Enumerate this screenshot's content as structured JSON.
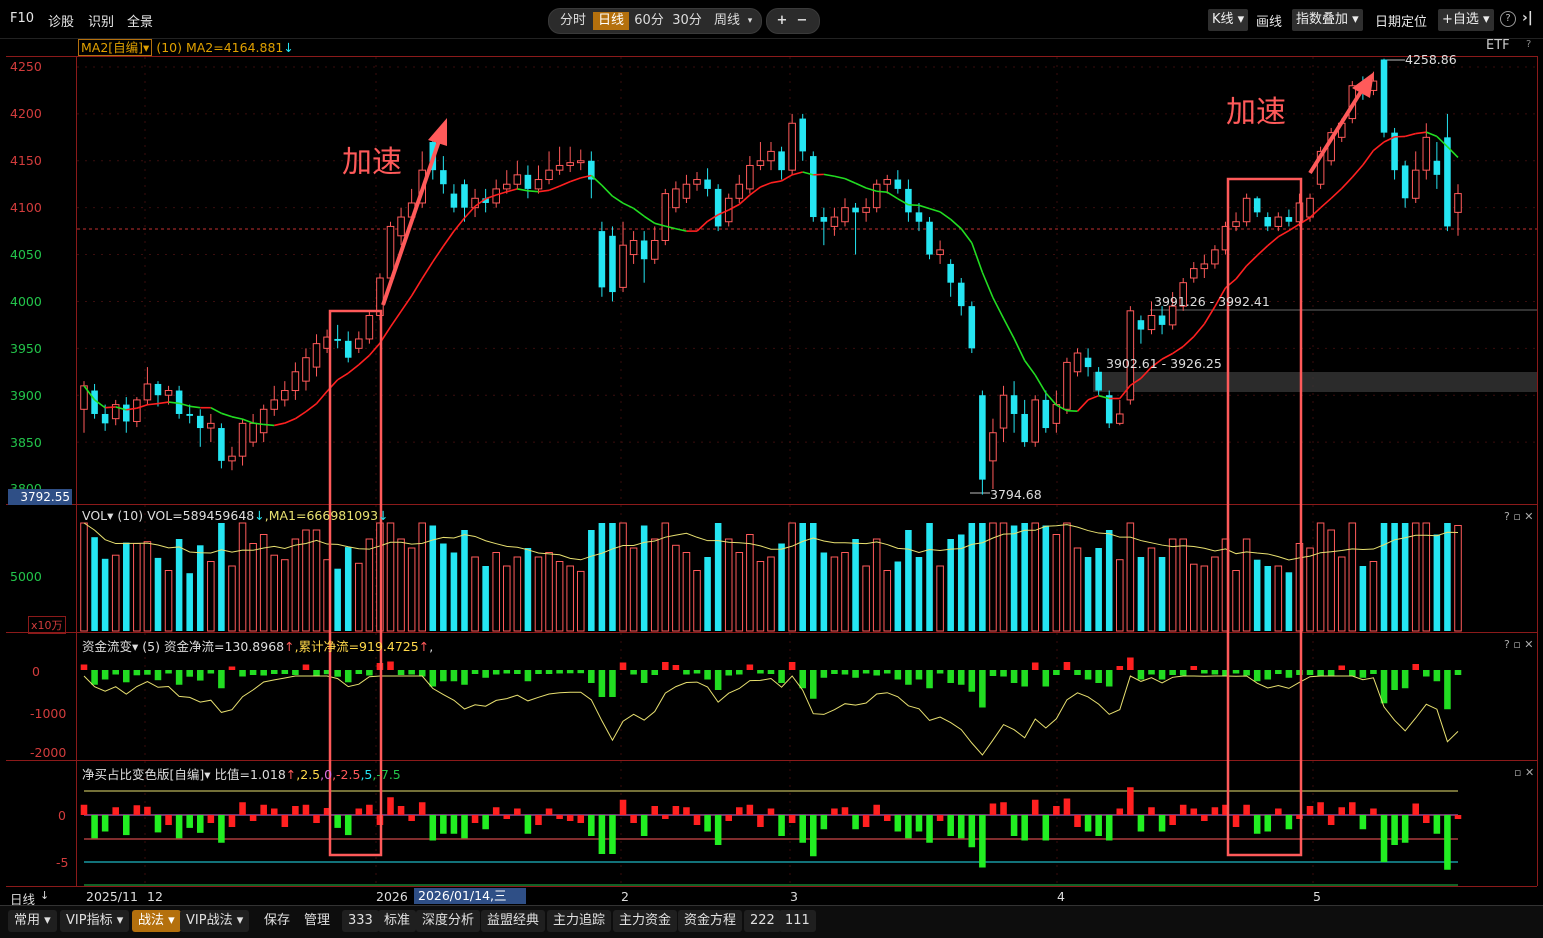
{
  "topbar": {
    "f10": "F10",
    "diagnose": "诊股",
    "recognize": "识别",
    "panorama": "全景",
    "modes": [
      "分时",
      "日线",
      "60分",
      "30分",
      "周线"
    ],
    "zoom_in": "+",
    "zoom_out": "−",
    "kline": "K线",
    "draw": "画线",
    "index_overlay": "指数叠加",
    "date_locate": "日期定位",
    "add_watch": "+自选",
    "help": "?",
    "etf": "ETF",
    "etf_help": "?"
  },
  "main": {
    "indicator_name": "MA2[自编]",
    "indicator_param": "(10)",
    "ma_value": "MA2=4164.881",
    "y_ticks": [
      "4250",
      "4200",
      "4150",
      "4100",
      "4050",
      "4000",
      "3950",
      "3900",
      "3850",
      "3800"
    ],
    "current_price": "3792.55",
    "high_label": "4258.86",
    "low_label": "3794.68",
    "zone_upper": "3991.26 - 3992.41",
    "zone_lower": "3902.61 - 3926.25",
    "annotation_1": "加速",
    "annotation_2": "加速"
  },
  "vol": {
    "title": "VOL",
    "param": "(10)",
    "vol_value": "VOL=589459648",
    "ma_value": ",MA1=666981093",
    "y_ticks": [
      "5000"
    ],
    "unit": "x10万"
  },
  "fund": {
    "title": "资金流变",
    "param": "(5)",
    "net": "资金净流=130.8968",
    "cum": "累计净流=919.4725",
    "y_ticks": [
      "0",
      "-1000",
      "-2000"
    ]
  },
  "netbuy": {
    "title": "净买占比变色版[自编]",
    "ratio": "比值=1.018",
    "lines": [
      ",2.5",
      ",0",
      ",-2.5",
      ",5",
      ",-7.5"
    ],
    "y_ticks": [
      "0",
      "-5"
    ]
  },
  "xaxis": {
    "period": "日线",
    "labels": [
      "2025/11",
      "12",
      "2026",
      "2",
      "3",
      "4",
      "5"
    ],
    "cursor_date": "2026/01/14,三"
  },
  "bottombar": {
    "items": [
      "常用",
      "VIP指标",
      "战法",
      "VIP战法",
      "保存",
      "管理",
      "333",
      "标准",
      "深度分析",
      "益盟经典",
      "主力追踪",
      "主力资金",
      "资金方程",
      "222",
      "111"
    ]
  },
  "colors": {
    "up": "#ff5a5a",
    "down": "#25e5f2",
    "ma_up": "#ff2020",
    "ma_down": "#22dd22",
    "grid_red": "#8b1a1a",
    "accent": "#b4700d"
  },
  "chart_data": {
    "type": "candlestick",
    "candles": [
      [
        3885,
        3910,
        3860,
        3915
      ],
      [
        3905,
        3880,
        3875,
        3912
      ],
      [
        3880,
        3870,
        3862,
        3890
      ],
      [
        3875,
        3890,
        3868,
        3895
      ],
      [
        3890,
        3872,
        3860,
        3898
      ],
      [
        3872,
        3895,
        3866,
        3898
      ],
      [
        3895,
        3912,
        3890,
        3930
      ],
      [
        3912,
        3900,
        3888,
        3915
      ],
      [
        3900,
        3905,
        3890,
        3910
      ],
      [
        3905,
        3880,
        3875,
        3910
      ],
      [
        3880,
        3878,
        3870,
        3890
      ],
      [
        3878,
        3865,
        3845,
        3885
      ],
      [
        3865,
        3870,
        3850,
        3880
      ],
      [
        3865,
        3830,
        3822,
        3870
      ],
      [
        3830,
        3835,
        3820,
        3845
      ],
      [
        3835,
        3870,
        3825,
        3875
      ],
      [
        3850,
        3870,
        3845,
        3880
      ],
      [
        3860,
        3885,
        3850,
        3890
      ],
      [
        3885,
        3895,
        3878,
        3910
      ],
      [
        3895,
        3905,
        3888,
        3915
      ],
      [
        3905,
        3925,
        3895,
        3935
      ],
      [
        3915,
        3940,
        3905,
        3950
      ],
      [
        3930,
        3955,
        3920,
        3965
      ],
      [
        3950,
        3962,
        3945,
        3970
      ],
      [
        3960,
        3958,
        3950,
        3975
      ],
      [
        3958,
        3940,
        3935,
        3968
      ],
      [
        3950,
        3960,
        3945,
        3968
      ],
      [
        3960,
        3985,
        3955,
        3990
      ],
      [
        3985,
        4025,
        3980,
        4030
      ],
      [
        4025,
        4080,
        4020,
        4085
      ],
      [
        4070,
        4090,
        4060,
        4100
      ],
      [
        4090,
        4105,
        4085,
        4120
      ],
      [
        4105,
        4140,
        4100,
        4160
      ],
      [
        4170,
        4140,
        4130,
        4175
      ],
      [
        4140,
        4125,
        4115,
        4155
      ],
      [
        4115,
        4100,
        4095,
        4125
      ],
      [
        4125,
        4100,
        4085,
        4130
      ],
      [
        4100,
        4110,
        4090,
        4120
      ],
      [
        4110,
        4105,
        4095,
        4120
      ],
      [
        4105,
        4120,
        4100,
        4130
      ],
      [
        4120,
        4125,
        4115,
        4140
      ],
      [
        4125,
        4135,
        4120,
        4150
      ],
      [
        4135,
        4120,
        4110,
        4145
      ],
      [
        4120,
        4130,
        4115,
        4145
      ],
      [
        4130,
        4140,
        4125,
        4160
      ],
      [
        4140,
        4145,
        4135,
        4165
      ],
      [
        4145,
        4148,
        4138,
        4165
      ],
      [
        4148,
        4150,
        4140,
        4162
      ],
      [
        4150,
        4130,
        4110,
        4160
      ],
      [
        4075,
        4015,
        4005,
        4085
      ],
      [
        4070,
        4010,
        4000,
        4080
      ],
      [
        4015,
        4060,
        4010,
        4085
      ],
      [
        4050,
        4065,
        4040,
        4075
      ],
      [
        4065,
        4045,
        4020,
        4075
      ],
      [
        4045,
        4065,
        4040,
        4080
      ],
      [
        4065,
        4115,
        4060,
        4120
      ],
      [
        4100,
        4120,
        4095,
        4128
      ],
      [
        4110,
        4125,
        4105,
        4135
      ],
      [
        4125,
        4130,
        4118,
        4138
      ],
      [
        4130,
        4120,
        4112,
        4142
      ],
      [
        4120,
        4080,
        4075,
        4125
      ],
      [
        4085,
        4110,
        4080,
        4115
      ],
      [
        4110,
        4125,
        4105,
        4135
      ],
      [
        4120,
        4145,
        4115,
        4155
      ],
      [
        4145,
        4150,
        4140,
        4170
      ],
      [
        4150,
        4160,
        4140,
        4170
      ],
      [
        4160,
        4140,
        4130,
        4165
      ],
      [
        4140,
        4190,
        4135,
        4200
      ],
      [
        4195,
        4160,
        4150,
        4200
      ],
      [
        4155,
        4090,
        4085,
        4160
      ],
      [
        4090,
        4085,
        4060,
        4100
      ],
      [
        4080,
        4090,
        4070,
        4100
      ],
      [
        4085,
        4100,
        4080,
        4110
      ],
      [
        4100,
        4095,
        4050,
        4105
      ],
      [
        4095,
        4100,
        4085,
        4110
      ],
      [
        4100,
        4125,
        4095,
        4130
      ],
      [
        4125,
        4130,
        4115,
        4135
      ],
      [
        4130,
        4120,
        4115,
        4140
      ],
      [
        4120,
        4095,
        4085,
        4130
      ],
      [
        4095,
        4085,
        4075,
        4105
      ],
      [
        4085,
        4050,
        4045,
        4090
      ],
      [
        4050,
        4055,
        4040,
        4065
      ],
      [
        4040,
        4020,
        4005,
        4045
      ],
      [
        4020,
        3995,
        3985,
        4025
      ],
      [
        3995,
        3950,
        3945,
        4000
      ],
      [
        3900,
        3810,
        3794,
        3905
      ],
      [
        3830,
        3860,
        3800,
        3875
      ],
      [
        3865,
        3900,
        3850,
        3910
      ],
      [
        3900,
        3880,
        3860,
        3915
      ],
      [
        3880,
        3850,
        3845,
        3895
      ],
      [
        3850,
        3895,
        3845,
        3900
      ],
      [
        3895,
        3865,
        3860,
        3905
      ],
      [
        3870,
        3890,
        3860,
        3905
      ],
      [
        3885,
        3935,
        3880,
        3940
      ],
      [
        3925,
        3945,
        3920,
        3950
      ],
      [
        3940,
        3930,
        3920,
        3950
      ],
      [
        3925,
        3905,
        3900,
        3930
      ],
      [
        3900,
        3870,
        3865,
        3905
      ],
      [
        3870,
        3880,
        3868,
        3895
      ],
      [
        3895,
        3990,
        3890,
        3995
      ],
      [
        3980,
        3970,
        3955,
        3985
      ],
      [
        3970,
        3985,
        3965,
        4000
      ],
      [
        3985,
        3975,
        3965,
        3995
      ],
      [
        3975,
        3995,
        3970,
        4010
      ],
      [
        3995,
        4020,
        3990,
        4025
      ],
      [
        4025,
        4035,
        4020,
        4042
      ],
      [
        4035,
        4040,
        4025,
        4050
      ],
      [
        4040,
        4055,
        4035,
        4060
      ],
      [
        4055,
        4080,
        4050,
        4085
      ],
      [
        4080,
        4085,
        4075,
        4095
      ],
      [
        4085,
        4110,
        4080,
        4115
      ],
      [
        4110,
        4095,
        4090,
        4112
      ],
      [
        4090,
        4080,
        4075,
        4095
      ],
      [
        4080,
        4090,
        4075,
        4095
      ],
      [
        4090,
        4085,
        4080,
        4098
      ],
      [
        4085,
        4105,
        4080,
        4115
      ],
      [
        4090,
        4110,
        4085,
        4115
      ],
      [
        4125,
        4160,
        4120,
        4165
      ],
      [
        4150,
        4180,
        4145,
        4185
      ],
      [
        4175,
        4190,
        4170,
        4195
      ],
      [
        4195,
        4230,
        4190,
        4235
      ],
      [
        4230,
        4225,
        4215,
        4240
      ],
      [
        4225,
        4235,
        4220,
        4245
      ],
      [
        4258,
        4180,
        4175,
        4258.86
      ],
      [
        4180,
        4140,
        4130,
        4185
      ],
      [
        4145,
        4110,
        4100,
        4150
      ],
      [
        4110,
        4140,
        4105,
        4160
      ],
      [
        4140,
        4175,
        4130,
        4190
      ],
      [
        4150,
        4135,
        4120,
        4170
      ],
      [
        4175,
        4080,
        4075,
        4200
      ],
      [
        4095,
        4115,
        4070,
        4125
      ]
    ],
    "ylim": [
      3790,
      4265
    ],
    "high": 4258.86,
    "low": 3794.68
  }
}
